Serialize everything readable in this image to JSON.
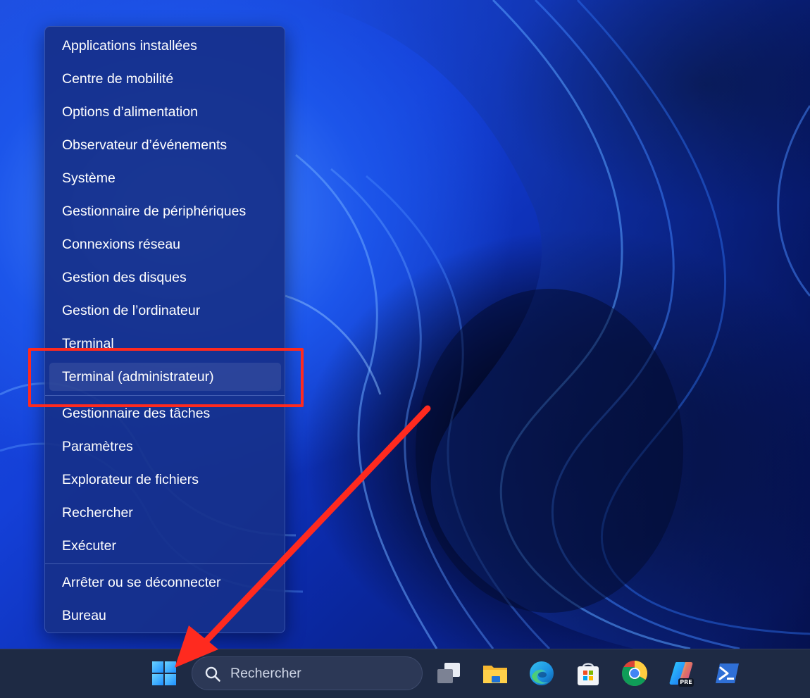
{
  "menu": {
    "items": [
      {
        "label": "Applications installées"
      },
      {
        "label": "Centre de mobilité"
      },
      {
        "label": "Options d’alimentation"
      },
      {
        "label": "Observateur d’événements"
      },
      {
        "label": "Système"
      },
      {
        "label": "Gestionnaire de périphériques"
      },
      {
        "label": "Connexions réseau"
      },
      {
        "label": "Gestion des disques"
      },
      {
        "label": "Gestion de l’ordinateur"
      },
      {
        "label": "Terminal"
      },
      {
        "label": "Terminal (administrateur)",
        "highlighted": true
      },
      {
        "label": "Gestionnaire des tâches"
      },
      {
        "label": "Paramètres"
      },
      {
        "label": "Explorateur de fichiers"
      },
      {
        "label": "Rechercher"
      },
      {
        "label": "Exécuter"
      },
      {
        "label": "Arrêter ou se déconnecter"
      },
      {
        "label": "Bureau"
      }
    ]
  },
  "annotation": {
    "color": "#ff2a1f",
    "target": "Terminal (administrateur)"
  },
  "taskbar": {
    "search_placeholder": "Rechercher",
    "icons": [
      "start-icon",
      "search-icon",
      "task-view-icon",
      "file-explorer-icon",
      "edge-icon",
      "microsoft-store-icon",
      "chrome-icon",
      "copilot-icon",
      "powershell-icon"
    ],
    "copilot_badge": "PRE"
  },
  "colors": {
    "menu_bg": "#16308a",
    "taskbar_bg": "#1e2a44",
    "accent": "#0078d4"
  }
}
